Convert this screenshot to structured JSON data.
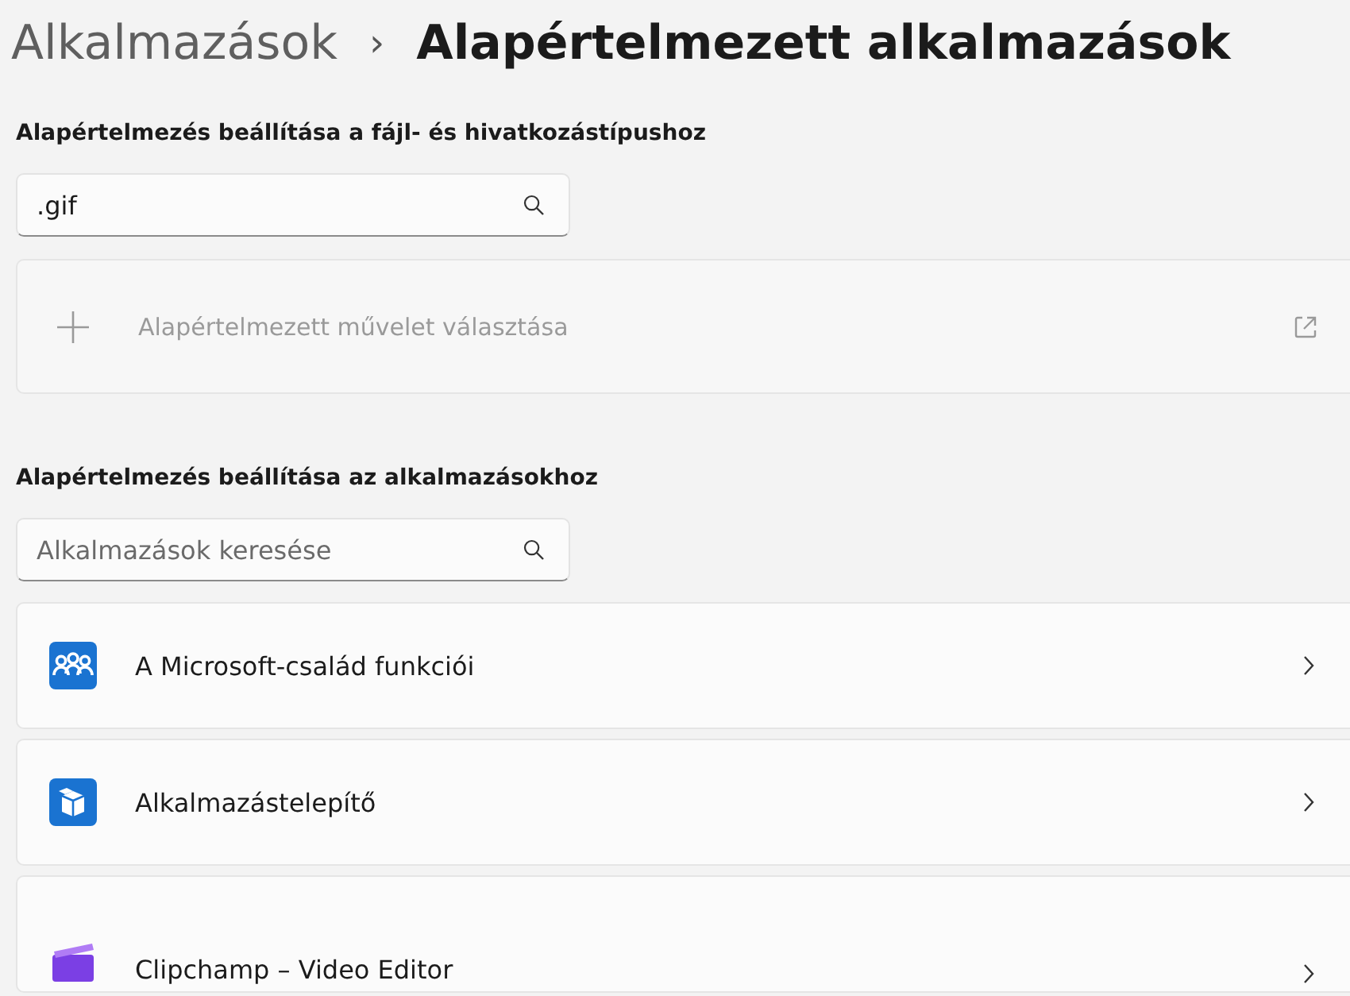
{
  "breadcrumb": {
    "parent": "Alkalmazások",
    "separator": "›",
    "current": "Alapértelmezett alkalmazások"
  },
  "file_types": {
    "heading": "Alapértelmezés beállítása a fájl- és hivatkozástípushoz",
    "search": {
      "value": ".gif"
    },
    "action": {
      "label": "Alapértelmezett művelet választása",
      "disabled": true
    }
  },
  "apps": {
    "heading": "Alapértelmezés beállítása az alkalmazásokhoz",
    "search": {
      "placeholder": "Alkalmazások keresése"
    },
    "items": [
      {
        "kind": "family",
        "name": "A Microsoft-család funkciói"
      },
      {
        "kind": "installer",
        "name": "Alkalmazástelepítő"
      },
      {
        "kind": "clipchamp",
        "name": "Clipchamp – Video Editor"
      }
    ]
  }
}
